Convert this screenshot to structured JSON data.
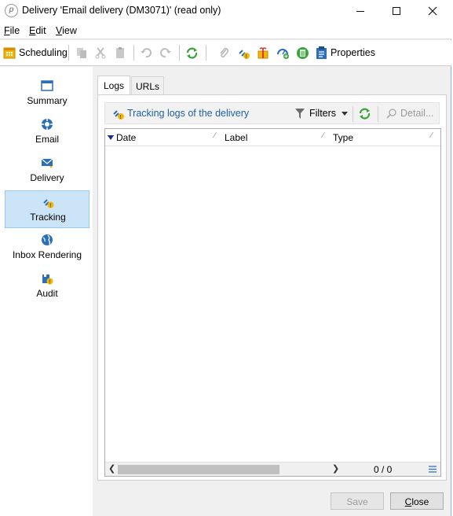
{
  "window": {
    "title": "Delivery 'Email delivery (DM3071)' (read only)",
    "app_icon_glyph": "p"
  },
  "menu": {
    "file_u": "F",
    "file_rest": "ile",
    "edit_u": "E",
    "edit_rest": "dit",
    "view_u": "V",
    "view_rest": "iew"
  },
  "toolbar": {
    "scheduling_label": "Scheduling",
    "properties_label": "Properties"
  },
  "nav": {
    "items": [
      {
        "label": "Summary",
        "icon": "summary-icon"
      },
      {
        "label": "Email",
        "icon": "email-icon"
      },
      {
        "label": "Delivery",
        "icon": "delivery-icon"
      },
      {
        "label": "Tracking",
        "icon": "tracking-icon"
      },
      {
        "label": "Inbox Rendering",
        "icon": "globe-icon"
      },
      {
        "label": "Audit",
        "icon": "audit-icon"
      }
    ],
    "selected": "Tracking"
  },
  "tabs": {
    "logs": "Logs",
    "urls": "URLs"
  },
  "subbar": {
    "title": "Tracking logs of the delivery",
    "filters": "Filters",
    "detail": "Detail..."
  },
  "grid": {
    "columns": [
      "Date",
      "Label",
      "Type"
    ],
    "rows": [],
    "count": "0 / 0"
  },
  "buttons": {
    "save": "Save",
    "close_u": "C",
    "close_rest": "lose"
  },
  "colors": {
    "accent": "#1e5fa6",
    "selected_bg": "#cce4f7",
    "refresh_green": "#3aa33a"
  }
}
